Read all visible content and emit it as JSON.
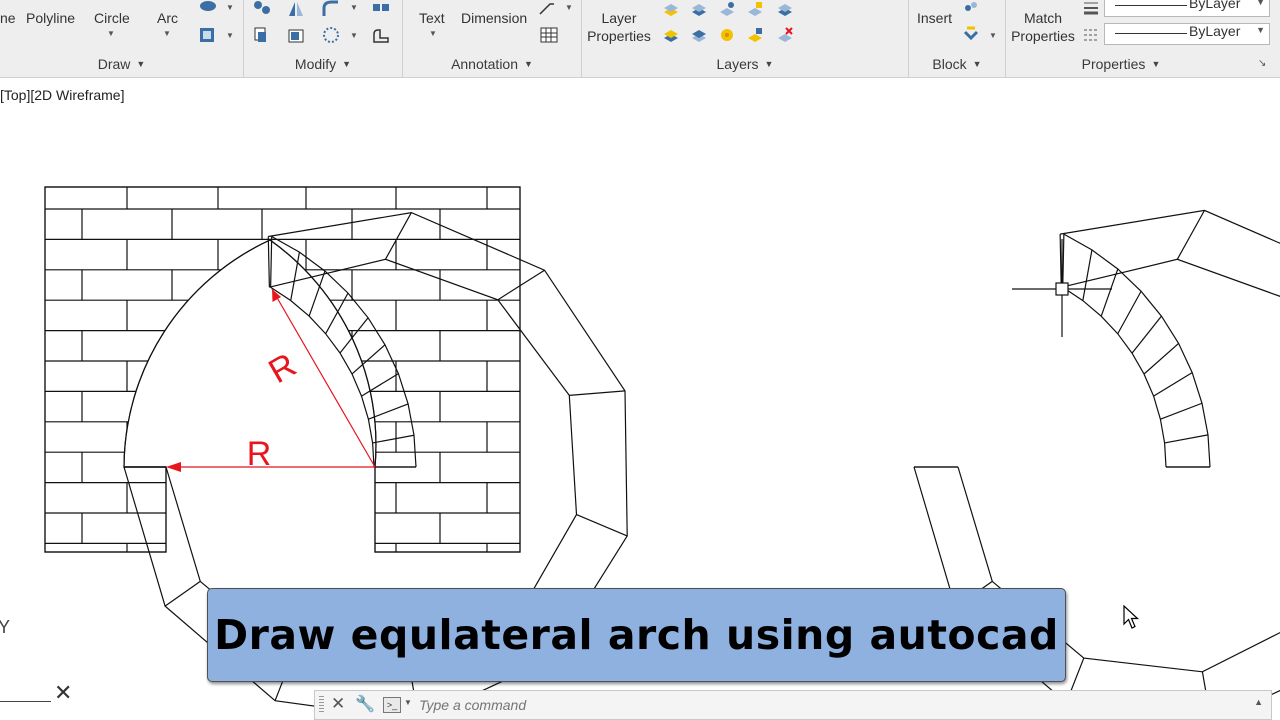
{
  "ribbon": {
    "draw": {
      "line_partial": "ne",
      "polyline": "Polyline",
      "circle": "Circle",
      "arc": "Arc",
      "panel_label": "Draw"
    },
    "modify": {
      "panel_label": "Modify"
    },
    "annotation": {
      "text": "Text",
      "dimension": "Dimension",
      "panel_label": "Annotation"
    },
    "layers": {
      "layer_properties_line1": "Layer",
      "layer_properties_line2": "Properties",
      "panel_label": "Layers"
    },
    "block": {
      "insert": "Insert",
      "panel_label": "Block"
    },
    "properties": {
      "match_line1": "Match",
      "match_line2": "Properties",
      "linetype_value": "ByLayer",
      "lineweight_value": "ByLayer",
      "panel_label": "Properties"
    }
  },
  "viewport": {
    "label": "[Top][2D Wireframe]"
  },
  "drawing": {
    "radius_label_diagonal": "R",
    "radius_label_horizontal": "R",
    "annotation_color": "#e8141e"
  },
  "caption": {
    "text": "Draw equlateral arch using autocad"
  },
  "command_line": {
    "placeholder": "Type a command"
  },
  "ucs": {
    "y_label": "Y"
  }
}
